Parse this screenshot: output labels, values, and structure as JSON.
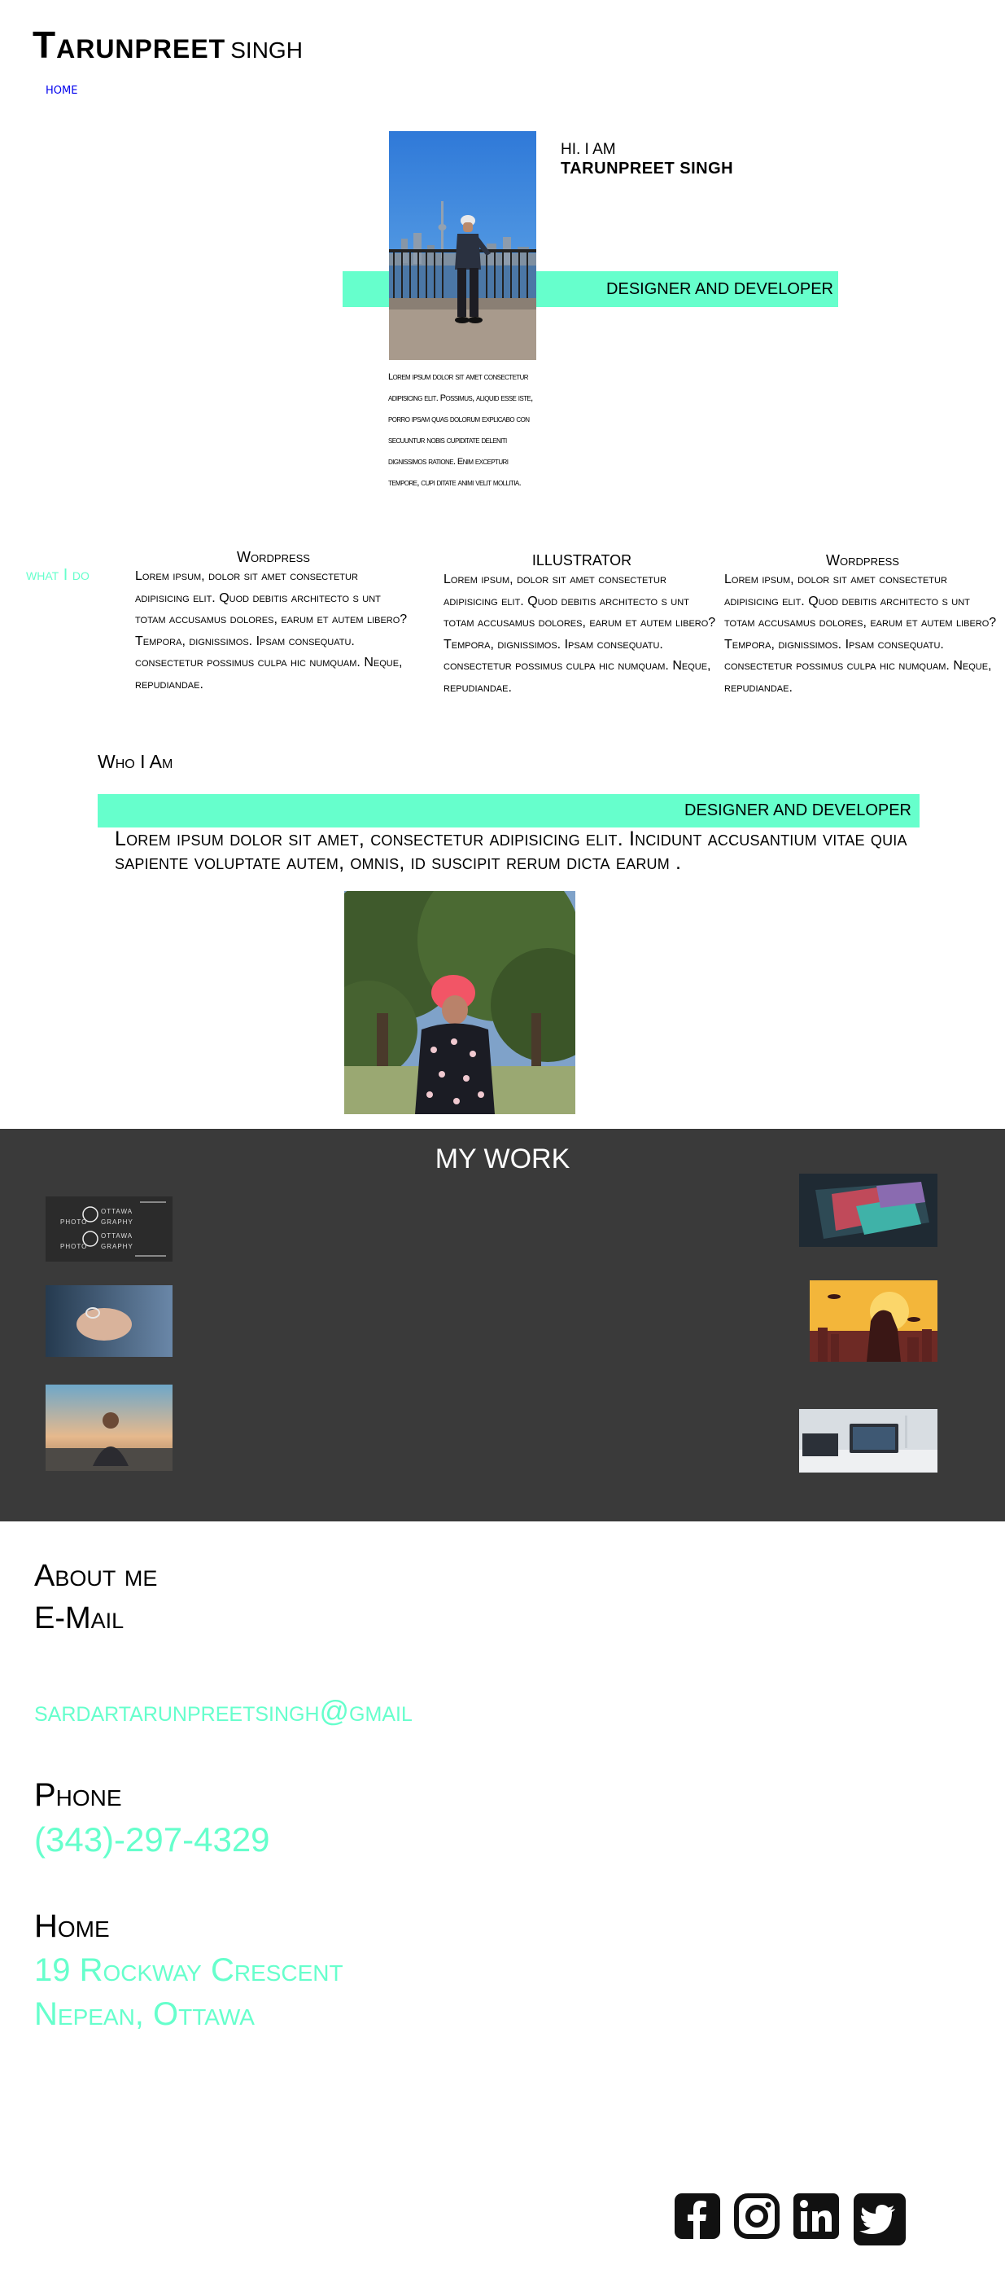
{
  "header": {
    "name_first": "Tarunpreet",
    "name_last": "Singh"
  },
  "nav": {
    "home": "HOME"
  },
  "hero": {
    "greeting": "HI. I AM",
    "name": "TARUNPREET SINGH",
    "band": "DESIGNER AND DEVELOPER",
    "paragraph": "Lorem ipsum dolor sit amet consectetur adipisicing elit. Possimus, aliquid esse iste, porro ipsam quas dolorum explicabo con secuuntur nobis cupiditate deleniti dignissimos ratione. Enim excepturi tempore, cupi ditate animi velit mollitia."
  },
  "what_i_do": {
    "heading": "what I do",
    "services": [
      {
        "title": "Wordpress",
        "body": "Lorem ipsum, dolor sit amet consectetur adipisicing elit. Quod debitis architecto s unt totam accusamus dolores, earum et autem libero? Tempora, dignissimos. Ipsam consequatu. consectetur possimus culpa hic numquam. Neque, repudiandae."
      },
      {
        "title": "ILLUSTRATOR",
        "body": "Lorem ipsum, dolor sit amet consectetur adipisicing elit. Quod debitis architecto s unt totam accusamus dolores, earum et autem libero? Tempora, dignissimos. Ipsam consequatu. consectetur possimus culpa hic numquam. Neque, repudiandae."
      },
      {
        "title": "Wordpress",
        "body": "Lorem ipsum, dolor sit amet consectetur adipisicing elit. Quod debitis architecto s unt totam accusamus dolores, earum et autem libero? Tempora, dignissimos. Ipsam consequatu. consectetur possimus culpa hic numquam. Neque, repudiandae."
      }
    ]
  },
  "who_i_am": {
    "heading": "Who I Am",
    "band": "DESIGNER AND DEVELOPER",
    "paragraph": "Lorem ipsum dolor sit amet, consectetur adipisicing elit. Incidunt accusantium vitae quia sapiente voluptate autem, omnis, id suscipit rerum dicta earum ."
  },
  "work": {
    "title": "MY WORK",
    "thumb_text": {
      "photography_a": "OTTAWA",
      "photography_b": "PHOTO",
      "photography_c": "GRAPHY"
    }
  },
  "about": {
    "title": "About me",
    "email_label": "E-Mail",
    "email": "sardartarunpreetsingh@gmail",
    "phone_label": "Phone",
    "phone": "(343)-297-4329",
    "home_label": "Home",
    "address_line1": "19 Rockway Crescent",
    "address_line2": "Nepean, Ottawa"
  },
  "social": [
    "facebook-icon",
    "instagram-icon",
    "linkedin-icon",
    "twitter-icon"
  ],
  "colors": {
    "accent": "#66ffcc",
    "dark": "#3a3a3a",
    "link": "#0000ee"
  }
}
